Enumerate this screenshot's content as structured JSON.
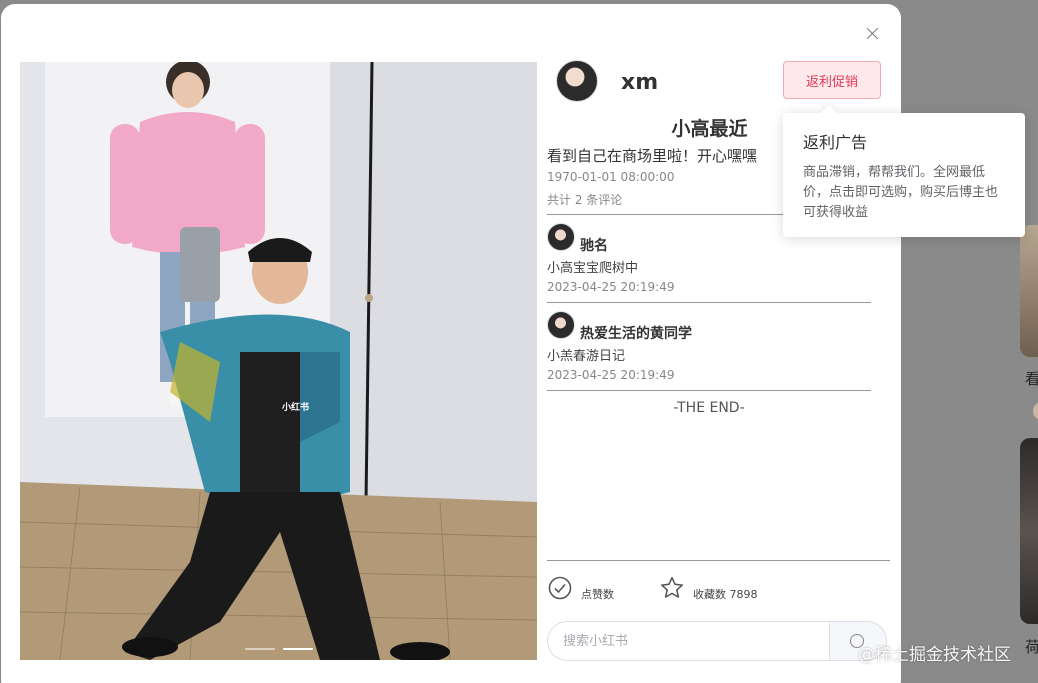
{
  "background": {
    "snippet_1": "看",
    "snippet_2": "荷"
  },
  "modal": {
    "photo": {
      "watermark": "小红书",
      "carousel_count": 2,
      "carousel_active": 2
    },
    "author": {
      "name": "xm"
    },
    "promo_button": "返利促销",
    "tooltip": {
      "title": "返利广告",
      "body": "商品滞销，帮帮我们。全网最低价，点击即可选购，购买后博主也可获得收益"
    },
    "note": {
      "title": "小高最近",
      "description": "看到自己在商场里啦！开心嘿嘿",
      "time": "1970-01-01 08:00:00",
      "comment_count": "共计 2 条评论"
    },
    "comments": [
      {
        "author": "驰名",
        "text": "小高宝宝爬树中",
        "time": "2023-04-25 20:19:49"
      },
      {
        "author": "热爱生活的黄同学",
        "text": "小羔春游日记",
        "time": "2023-04-25 20:19:49"
      }
    ],
    "end_text": "-THE END-",
    "actions": {
      "like_label": "点赞数",
      "favorite_label": "收藏数 7898"
    },
    "input": {
      "placeholder": "搜索小红书"
    }
  },
  "site_watermark": "@稀土掘金技术社区",
  "colors": {
    "promo_text": "#e53a55",
    "promo_bg": "#fde8ec",
    "overlay": "#8a8a8a"
  }
}
